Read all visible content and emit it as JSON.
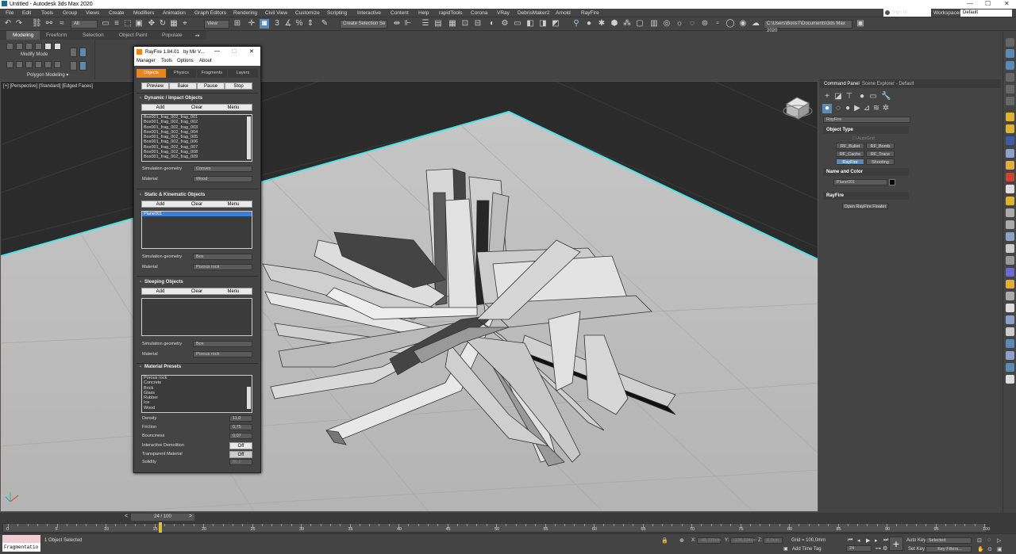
{
  "window": {
    "title": "Untitled - Autodesk 3ds Max 2020"
  },
  "menu": [
    "File",
    "Edit",
    "Tools",
    "Group",
    "Views",
    "Create",
    "Modifiers",
    "Animation",
    "Graph Editors",
    "Rendering",
    "Civil View",
    "Customize",
    "Scripting",
    "Interactive",
    "Content",
    "Help",
    "rapidTools",
    "Corona",
    "VRay",
    "DebrisMaker2",
    "Arnold",
    "RayFire"
  ],
  "signin": {
    "label": "Sign In",
    "workspaces_label": "Workspaces:",
    "workspace": "Default"
  },
  "toolbar": {
    "filter": "All",
    "view": "View",
    "selection_set": "Create Selection Se",
    "path": "C:\\Users\\BorisT\\Documents\\3ds Max 2020"
  },
  "ribbon": {
    "tabs": [
      "Modeling",
      "Freeform",
      "Selection",
      "Object Paint",
      "Populate"
    ],
    "active": "Modeling",
    "modify_mode": "Modify Mode",
    "polygon_modeling": "Polygon Modeling"
  },
  "viewport": {
    "label": "[+] [Perspective] [Standard] [Edged Faces]"
  },
  "command_panel": {
    "tabs": [
      "Command Panel",
      "Scene Explorer - Default"
    ],
    "category": "RayFire",
    "object_type": {
      "title": "Object Type",
      "autogrid": "AutoGrid",
      "buttons": [
        "RF_Bullet",
        "RF_Bomb",
        "RF_Cache",
        "RF_Trace",
        "RayFire",
        "Shooting"
      ],
      "active": "RayFire"
    },
    "name_color": {
      "title": "Name and Color",
      "name": "Plane001"
    },
    "rayfire": {
      "title": "RayFire",
      "button": "Open RayFire Floater"
    }
  },
  "rayfire_window": {
    "title": "RayFire 1.84.01",
    "author": "by Mir V...",
    "menu": [
      "Manager",
      "Tools",
      "Options",
      "About"
    ],
    "tabs": [
      "Objects",
      "Physics",
      "Fragments",
      "Layers"
    ],
    "active_tab": "Objects",
    "controls": [
      "Preview",
      "Bake",
      "Pause",
      "Stop"
    ],
    "dynamic": {
      "title": "Dynamic / Impact Objects",
      "buttons": [
        "Add",
        "Clear",
        "Menu"
      ],
      "items": [
        "Box001_frag_002_frag_001",
        "Box001_frag_002_frag_002",
        "Box001_frag_002_frag_003",
        "Box001_frag_002_frag_004",
        "Box001_frag_002_frag_005",
        "Box001_frag_002_frag_006",
        "Box001_frag_002_frag_007",
        "Box001_frag_002_frag_008",
        "Box001_frag_002_frag_009"
      ],
      "sim_geo_label": "Simulation geometry",
      "sim_geo": "Convex",
      "material_label": "Material",
      "material": "Wood"
    },
    "static": {
      "title": "Static & Kinematic Objects",
      "buttons": [
        "Add",
        "Clear",
        "Menu"
      ],
      "items": [
        "Plane001"
      ],
      "sim_geo_label": "Simulation geometry",
      "sim_geo": "Box",
      "material_label": "Material",
      "material": "Porous rock"
    },
    "sleeping": {
      "title": "Sleeping Objects",
      "buttons": [
        "Add",
        "Clear",
        "Menu"
      ],
      "sim_geo_label": "Simulation geometry",
      "sim_geo": "Box",
      "material_label": "Material",
      "material": "Porous rock"
    },
    "presets": {
      "title": "Material Presets",
      "items": [
        "Porous rock",
        "Concrete",
        "Brick",
        "Glass",
        "Rubber",
        "Ice",
        "Wood"
      ],
      "density_label": "Density",
      "density": "11,0",
      "friction_label": "Friction",
      "friction": "0,75",
      "bounciness_label": "Bounciness",
      "bounciness": "0,07",
      "demolition_label": "Interactive Demolition",
      "demolition": "Off",
      "transparent_label": "Transparent Material",
      "transparent": "Off",
      "solidity_label": "Solidity",
      "solidity": "80,0"
    }
  },
  "timeline": {
    "frame": "24 / 100",
    "ticks": [
      "0",
      "5",
      "10",
      "15",
      "20",
      "25",
      "30",
      "35",
      "40",
      "45",
      "50",
      "55",
      "60",
      "65",
      "70",
      "75",
      "80",
      "85",
      "90",
      "95",
      "100"
    ]
  },
  "status": {
    "maxscript": "Fragmentatio",
    "selected": "1 Object Selected",
    "x_label": "X:",
    "x": "-40,135cm",
    "y_label": "Y:",
    "y": "-126,934cm",
    "z_label": "Z:",
    "z": "0,0cm",
    "grid": "Grid = 100,0mm",
    "add_time_tag": "Add Time Tag",
    "auto_key": "Auto Key",
    "set_key": "Set Key",
    "key_mode": "Selected",
    "key_filters": "Key Filters...",
    "frame": "24"
  },
  "colors": {
    "accent": "#e8851f",
    "select_blue": "#5b8ab5",
    "viewport_bg": "#2b2b2b",
    "ground": "#bdbdbd",
    "edge_cyan": "#4fe3e8"
  }
}
